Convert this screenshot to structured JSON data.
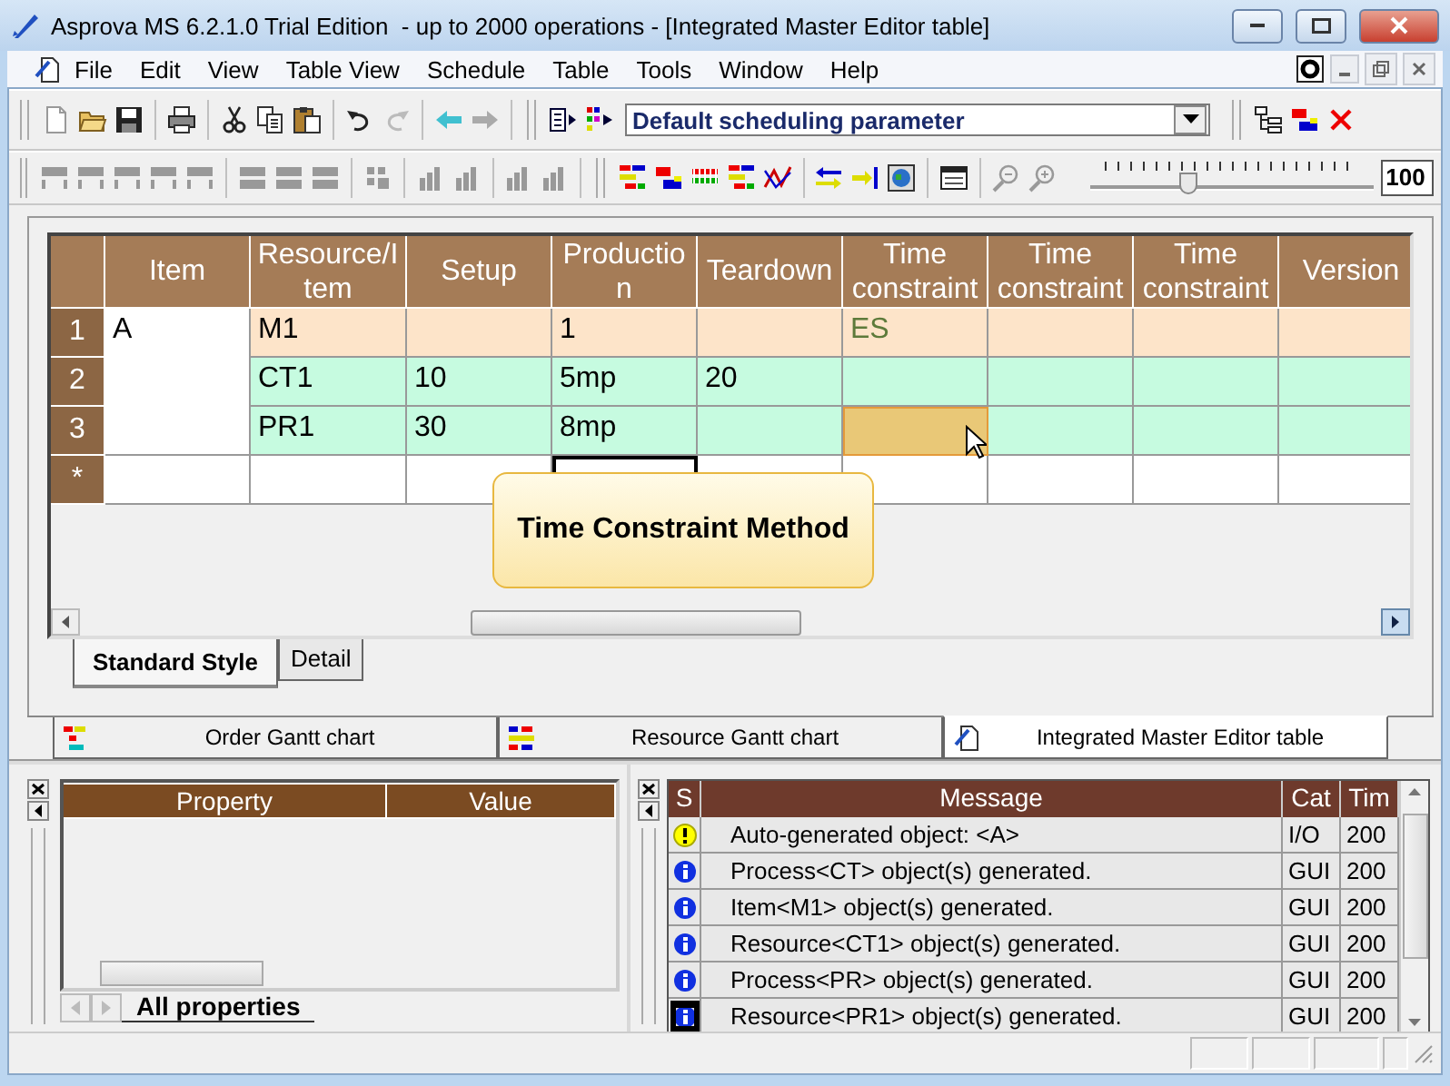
{
  "window": {
    "title": "Asprova MS 6.2.1.0 Trial Edition  - up to 2000 operations - [Integrated Master Editor table]"
  },
  "menu": [
    "File",
    "Edit",
    "View",
    "Table View",
    "Schedule",
    "Table",
    "Tools",
    "Window",
    "Help"
  ],
  "toolbar": {
    "parameter_dropdown": {
      "value": "Default scheduling parameter"
    },
    "zoom": {
      "level": 0.35,
      "value": "100"
    }
  },
  "table": {
    "columns": [
      "Item",
      "Resource/Item",
      "Setup",
      "Production",
      "Teardown",
      "Time constraint",
      "Time constraint",
      "Time constraint",
      "Version"
    ],
    "rows": [
      {
        "header": "1",
        "kind": "item",
        "item": "A",
        "resource_item": "M1",
        "production": "1",
        "time_constraint_1": "ES"
      },
      {
        "header": "2",
        "kind": "operation",
        "resource_item": "CT1",
        "setup": "10",
        "production": "5mp",
        "teardown": "20"
      },
      {
        "header": "3",
        "kind": "operation",
        "resource_item": "PR1",
        "setup": "30",
        "production": "8mp",
        "time_constraint_1": {
          "selected": true
        }
      },
      {
        "header": "*",
        "kind": "new",
        "production": {
          "focused": true
        }
      }
    ]
  },
  "tooltip": "Time Constraint Method",
  "sheet_tabs": [
    {
      "label": "Standard Style",
      "selected": true
    },
    {
      "label": "Detail",
      "selected": false
    }
  ],
  "document_tabs": [
    {
      "kind": "order_gantt",
      "label": "Order Gantt chart",
      "selected": false
    },
    {
      "kind": "resource_gantt",
      "label": "Resource Gantt chart",
      "selected": false
    },
    {
      "kind": "editor",
      "label": "Integrated Master Editor table",
      "selected": true
    }
  ],
  "property_panel": {
    "columns": [
      "Property",
      "Value"
    ],
    "tabs": [
      {
        "label": "All properties",
        "selected": true
      }
    ]
  },
  "message_panel": {
    "columns": [
      "S",
      "Message",
      "Cat",
      "Tim"
    ],
    "rows": [
      {
        "kind": "warning",
        "message": "Auto-generated object: <A>",
        "cat": "I/O",
        "time": "200",
        "selected": false
      },
      {
        "kind": "info",
        "message": "Process<CT> object(s) generated.",
        "cat": "GUI",
        "time": "200",
        "selected": false
      },
      {
        "kind": "info",
        "message": "Item<M1> object(s) generated.",
        "cat": "GUI",
        "time": "200",
        "selected": false
      },
      {
        "kind": "info",
        "message": "Resource<CT1> object(s) generated.",
        "cat": "GUI",
        "time": "200",
        "selected": false
      },
      {
        "kind": "info",
        "message": "Process<PR> object(s) generated.",
        "cat": "GUI",
        "time": "200",
        "selected": false
      },
      {
        "kind": "info",
        "message": "Resource<PR1> object(s) generated.",
        "cat": "GUI",
        "time": "200",
        "selected": true
      }
    ]
  }
}
